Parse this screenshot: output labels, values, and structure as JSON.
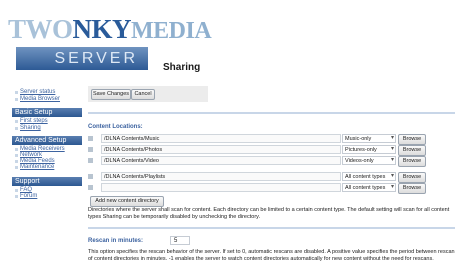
{
  "logo": {
    "part1": "TWO",
    "part2": "NKY",
    "part3": "MEDIA",
    "server_label": "SERVER"
  },
  "page_title": "Sharing",
  "nav": {
    "basic_setup": {
      "title": "Basic Setup",
      "items": [
        "Server status",
        "Media Browser",
        "First steps",
        "Sharing"
      ]
    },
    "advanced_setup": {
      "title": "Advanced Setup",
      "items": [
        "Media Receivers",
        "Network",
        "Media Feeds",
        "Maintenance"
      ]
    },
    "support": {
      "title": "Support",
      "items": [
        "FAQ",
        "Forum"
      ]
    }
  },
  "toolbar": {
    "save_label": "Save Changes",
    "cancel_label": "Cancel"
  },
  "content_locations": {
    "heading": "Content Locations:",
    "rows": [
      {
        "path": "/DLNA Contents/Music",
        "type": "Music-only",
        "browse": "Browse"
      },
      {
        "path": "/DLNA Contents/Photos",
        "type": "Pictures-only",
        "browse": "Browse"
      },
      {
        "path": "/DLNA Contents/Video",
        "type": "Videos-only",
        "browse": "Browse"
      },
      {
        "path": "/DLNA Contents/Playlists",
        "type": "All content types",
        "browse": "Browse"
      },
      {
        "path": "",
        "type": "All content types",
        "browse": "Browse"
      }
    ],
    "add_label": "Add new content directory",
    "description": "Directories where the server shall scan for content. Each directory can be limited to a certain content type. The default setting will scan for all content types Sharing can be temporarily disabled by unchecking the directory."
  },
  "rescan": {
    "label": "Rescan in minutes:",
    "value": "5",
    "description": "This option specifies the rescan behavior of the server. If set to 0, automatic rescans are disabled. A positive value specifies the period between rescan of content directories in minutes. -1 enables the server to watch content directories automatically for new content without the need for rescans."
  },
  "colors": {
    "accent": "#3d63a0",
    "nav_header": "#2c5891",
    "rule": "#c8d6e8"
  }
}
